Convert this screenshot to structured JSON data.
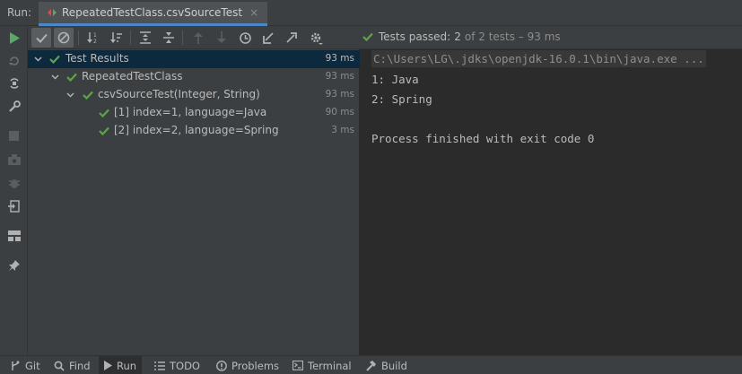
{
  "run_label": "Run:",
  "tab": {
    "title": "RepeatedTestClass.csvSourceTest",
    "close": "×"
  },
  "status": {
    "passed_label": "Tests passed:",
    "count": "2",
    "rest": "of 2 tests – 93 ms"
  },
  "tree": {
    "root": {
      "label": "Test Results",
      "time": "93 ms"
    },
    "class": {
      "label": "RepeatedTestClass",
      "time": "93 ms"
    },
    "method": {
      "label": "csvSourceTest(Integer, String)",
      "time": "93 ms"
    },
    "cases": [
      {
        "label": "[1] index=1, language=Java",
        "time": "90 ms"
      },
      {
        "label": "[2] index=2, language=Spring",
        "time": "3 ms"
      }
    ]
  },
  "console": {
    "command": "C:\\Users\\LG\\.jdks\\openjdk-16.0.1\\bin\\java.exe ...",
    "lines": [
      "1: Java",
      "2: Spring",
      "",
      "Process finished with exit code 0"
    ]
  },
  "bottom": {
    "git": "Git",
    "find": "Find",
    "run": "Run",
    "todo": "TODO",
    "problems": "Problems",
    "terminal": "Terminal",
    "build": "Build"
  },
  "colors": {
    "pass": "#5fa34b",
    "run": "#59a869",
    "accent": "#4a88c7",
    "selection": "#0d293e"
  }
}
